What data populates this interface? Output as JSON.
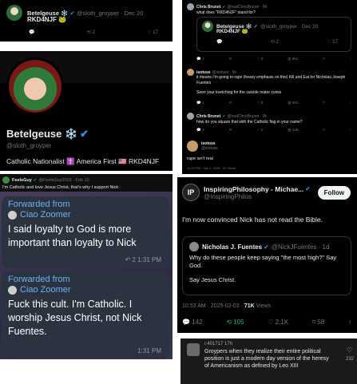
{
  "p1": {
    "name": "Betelgeuse ❄️",
    "handle": "@sloth_groyper · Dec 20",
    "text": "RKD4NJF 🐸",
    "actions": [
      "",
      "2",
      "",
      "17"
    ]
  },
  "p2": {
    "name": "Betelgeuse ❄️",
    "handle": "@sloth_groyper",
    "bio": "Catholic Nationalist ✝️ America First 🇺🇸 RKD4NJF"
  },
  "p3": {
    "t1_name": "Chris Brunet",
    "t1_handle": "@realChrisBrunet · 9h",
    "t1_text": "what does \"RKD4NJF\" stand for?",
    "quote_name": "Betelgeuse ❄️",
    "quote_handle": "@sloth_groyper · Dec 20",
    "quote_text": "RKD4NJF 🐸",
    "quote_actions": [
      "",
      "2",
      "",
      "17"
    ],
    "t1_actions": [
      "4",
      "",
      "3",
      "851",
      "",
      ""
    ],
    "t2_name": "isotuss",
    "t2_handle": "@isotuss · 9h",
    "t2_text": "it means I'm going to rape (heavy emphasis on this) Kill and Eat for Nicholas Joseph Fuentes",
    "t2_text2": "Seen your kvetching for the suicide mater cuinis",
    "t2_actions": [
      "1",
      "",
      "8",
      "631",
      "",
      ""
    ],
    "t3_name": "Chris Brunet",
    "t3_handle": "@realChrisBrunet · 9h",
    "t3_text": "how do you square that with the Catholic flag in your name?",
    "t3_actions": [
      "1",
      "",
      "2",
      "138",
      "",
      ""
    ],
    "t4_name": "isotuss",
    "t4_handle": "@isotuss",
    "t4_text": "rape isn't real",
    "t4_meta": "11:29 PM · Jan 1, 2025 · 22 Views"
  },
  "p4": {
    "name": "FeelsGuy",
    "handle": "@FeelsGuy2003 · Feb 10",
    "text": "I'm Catholic and love Jesus Christ, that's why I support Nick",
    "fw1_label": "Forwarded from",
    "fw1_from": "Ciao Zoomer",
    "fw1_text": "I said loyalty to God is more important than loyalty to Nick",
    "fw1_meta": "↶ 2  1:31 PM",
    "fw2_label": "Forwarded from",
    "fw2_from": "Ciao Zoomer",
    "fw2_text": "Fuck this cult. I'm Catholic. I worship Jesus Christ,  not Nick Fuentes.",
    "fw2_meta": "1:31 PM"
  },
  "p5": {
    "name": "InspiringPhilosophy - Michae...",
    "handle": "@InspiringPhilos",
    "follow": "Follow",
    "text": "I'm now convinced Nick has not read the Bible.",
    "quote_name": "Nicholas J. Fuentes",
    "quote_handle": "@NickJFuentes · 1d",
    "quote_text1": "Why do these people keep saying \"the most high?\" Say God.",
    "quote_text2": "Say Jesus Christ.",
    "meta_time": "10:53 AM · 2025-02-03 · ",
    "meta_views": "71K",
    "meta_views_label": " Views",
    "actions": [
      "142",
      "105",
      "2.1K",
      "58",
      ""
    ]
  },
  "p6": {
    "handle": "r.401717  17h",
    "text": "Groypers when they realize their entire political position is just a modern day version of the heresy of Americanism as defined by Leo XIII",
    "likes": "232"
  },
  "colors": {
    "blue": "#1d9bf0",
    "green": "#00ba7c",
    "telegram_blue": "#6ab3f3"
  }
}
